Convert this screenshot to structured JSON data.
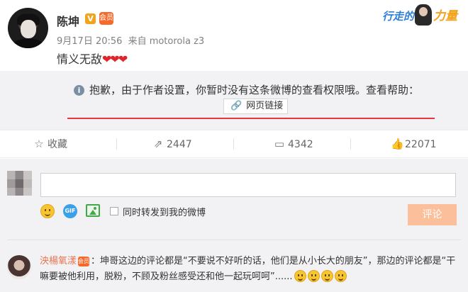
{
  "post": {
    "username": "陈坤",
    "verified_mark": "V",
    "vip_mark": "会员",
    "time": "9月17日 20:56",
    "source": "来自 motorola z3",
    "text": "情义无敌",
    "hearts": "❤❤❤"
  },
  "campaign_banner": {
    "part1": "行走的",
    "part2": "力量"
  },
  "notice": {
    "info_glyph": "i",
    "message": "抱歉，由于作者设置，你暂时没有这条微博的查看权限哦。查看帮助：",
    "link_label": "网页链接",
    "link_glyph": "🔗"
  },
  "actions": {
    "favorite": {
      "icon": "star-icon",
      "glyph": "☆",
      "label": "收藏"
    },
    "repost": {
      "icon": "share-icon",
      "glyph": "⇗",
      "label": "2447"
    },
    "comment": {
      "icon": "comment-icon",
      "glyph": "▭",
      "label": "4342"
    },
    "like": {
      "icon": "thumbs-up-icon",
      "glyph": "👍",
      "label": "22071"
    }
  },
  "composer": {
    "input_value": "",
    "gif_label": "GIF",
    "repost_checkbox_label": "同时转发到我的微博",
    "submit_label": "评论"
  },
  "comments": [
    {
      "name": "泱楊氧漾",
      "badge": "会员",
      "text": "：坤哥这边的评论都是“不要说不好听的话，他们是从小长大的朋友”，那边的评论都是“干嘛要被他利用，脱粉，不顾及粉丝感受还和他一起玩呵呵”......"
    }
  ],
  "colors": {
    "accent_orange": "#eb7350",
    "notice_rule": "#e8373c",
    "submit_disabled": "#fcbf9b",
    "panel_bg": "#f2f2f5"
  }
}
